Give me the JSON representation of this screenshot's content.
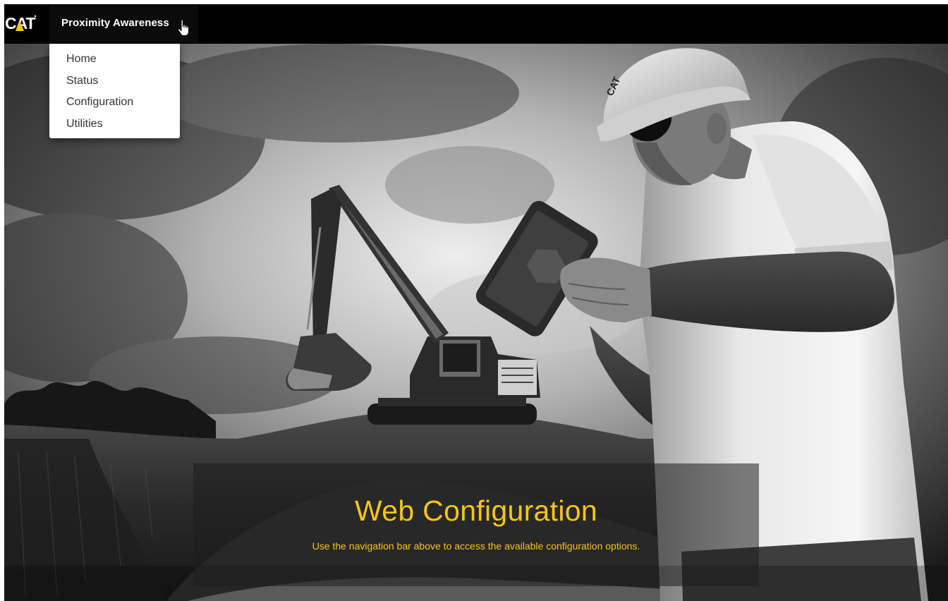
{
  "brand": {
    "logo_text": "CAT"
  },
  "navbar": {
    "dropdown_label": "Proximity Awareness",
    "menu_items": [
      {
        "label": "Home"
      },
      {
        "label": "Status"
      },
      {
        "label": "Configuration"
      },
      {
        "label": "Utilities"
      }
    ]
  },
  "hero": {
    "title": "Web Configuration",
    "subtitle": "Use the navigation bar above to access the available configuration options.",
    "helmet_logo": "CAT"
  },
  "colors": {
    "accent": "#f5c518",
    "navbar_bg": "#000000",
    "menu_bg": "#ffffff",
    "menu_text": "#333333"
  }
}
